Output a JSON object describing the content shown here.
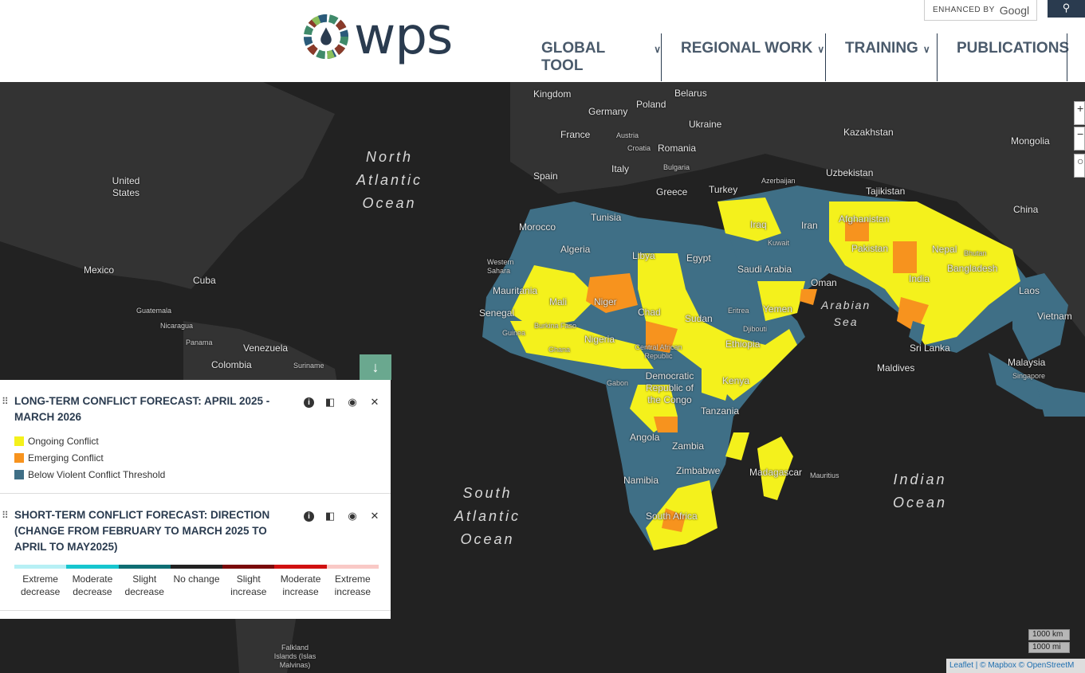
{
  "header": {
    "logo_text": "wps",
    "google": {
      "enhanced_by": "ENHANCED BY",
      "brand": "Googl"
    },
    "nav": [
      {
        "label": "GLOBAL TOOL",
        "has_dropdown": true
      },
      {
        "label": "REGIONAL WORK",
        "has_dropdown": true
      },
      {
        "label": "TRAINING",
        "has_dropdown": true
      },
      {
        "label": "PUBLICATIONS",
        "has_dropdown": false
      }
    ],
    "search_icon": "search-icon"
  },
  "map": {
    "countries": [
      "Kingdom",
      "Belarus",
      "Poland",
      "Germany",
      "Ukraine",
      "Kazakhstan",
      "France",
      "Austria",
      "Croatia",
      "Romania",
      "Mongolia",
      "Bulgaria",
      "Italy",
      "Spain",
      "Greece",
      "Turkey",
      "Azerbaijan",
      "Uzbekistan",
      "Tajikistan",
      "China",
      "Tunisia",
      "Morocco",
      "Algeria",
      "Libya",
      "Egypt",
      "Iraq",
      "Kuwait",
      "Iran",
      "Afghanistan",
      "Pakistan",
      "Nepal",
      "Bhutan",
      "Bangladesh",
      "India",
      "Saudi Arabia",
      "Oman",
      "Western Sahara",
      "Mauritania",
      "Mali",
      "Niger",
      "Chad",
      "Sudan",
      "Eritrea",
      "Yemen",
      "Djibouti",
      "Senegal",
      "Burkina Faso",
      "Guinea",
      "Ghana",
      "Nigeria",
      "Central African Republic",
      "Ethiopia",
      "Gabon",
      "Democratic Republic of the Congo",
      "Kenya",
      "Tanzania",
      "Angola",
      "Zambia",
      "Zimbabwe",
      "Namibia",
      "Madagascar",
      "Mauritius",
      "South Africa",
      "Sri Lanka",
      "Maldives",
      "Laos",
      "Vietnam",
      "Malaysia",
      "Singapore",
      "United States",
      "Mexico",
      "Cuba",
      "Guatemala",
      "Nicaragua",
      "Panama",
      "Venezuela",
      "Colombia",
      "Suriname",
      "Falkland Islands (Islas Malvinas)"
    ],
    "oceans": [
      "North\nAtlantic\nOcean",
      "South\nAtlantic\nOcean",
      "Arabian\nSea",
      "Indian\nOcean"
    ],
    "zoom_in": "+",
    "zoom_out": "−",
    "collapse_icon": "arrow-down-icon",
    "scale": [
      "1000 km",
      "1000 mi"
    ],
    "attribution": "Leaflet | © Mapbox © OpenStreetM",
    "colors": {
      "ongoing": "#f4f11c",
      "emerging": "#f7931e",
      "below": "#3f6f86",
      "land": "#333333",
      "water": "#222222"
    }
  },
  "legend": {
    "long_term": {
      "title": "LONG-TERM CONFLICT FORECAST: APRIL 2025 - MARCH 2026",
      "items": [
        {
          "label": "Ongoing Conflict",
          "color": "#f4f11c"
        },
        {
          "label": "Emerging Conflict",
          "color": "#f7931e"
        },
        {
          "label": "Below Violent Conflict Threshold",
          "color": "#3f6f86"
        }
      ]
    },
    "short_term": {
      "title": "SHORT-TERM CONFLICT FORECAST: DIRECTION (CHANGE FROM FEBRUARY TO MARCH 2025 TO APRIL TO MAY2025)",
      "scale": [
        {
          "label": "Extreme decrease",
          "color": "#b7f0f5"
        },
        {
          "label": "Moderate decrease",
          "color": "#17c6cf"
        },
        {
          "label": "Slight decrease",
          "color": "#0f6e73"
        },
        {
          "label": "No change",
          "color": "#222222"
        },
        {
          "label": "Slight increase",
          "color": "#7a0a0a"
        },
        {
          "label": "Moderate increase",
          "color": "#d01010"
        },
        {
          "label": "Extreme increase",
          "color": "#f9c9c6"
        }
      ]
    },
    "controls": [
      "info-icon",
      "opacity-icon",
      "eye-icon",
      "close-icon"
    ]
  }
}
